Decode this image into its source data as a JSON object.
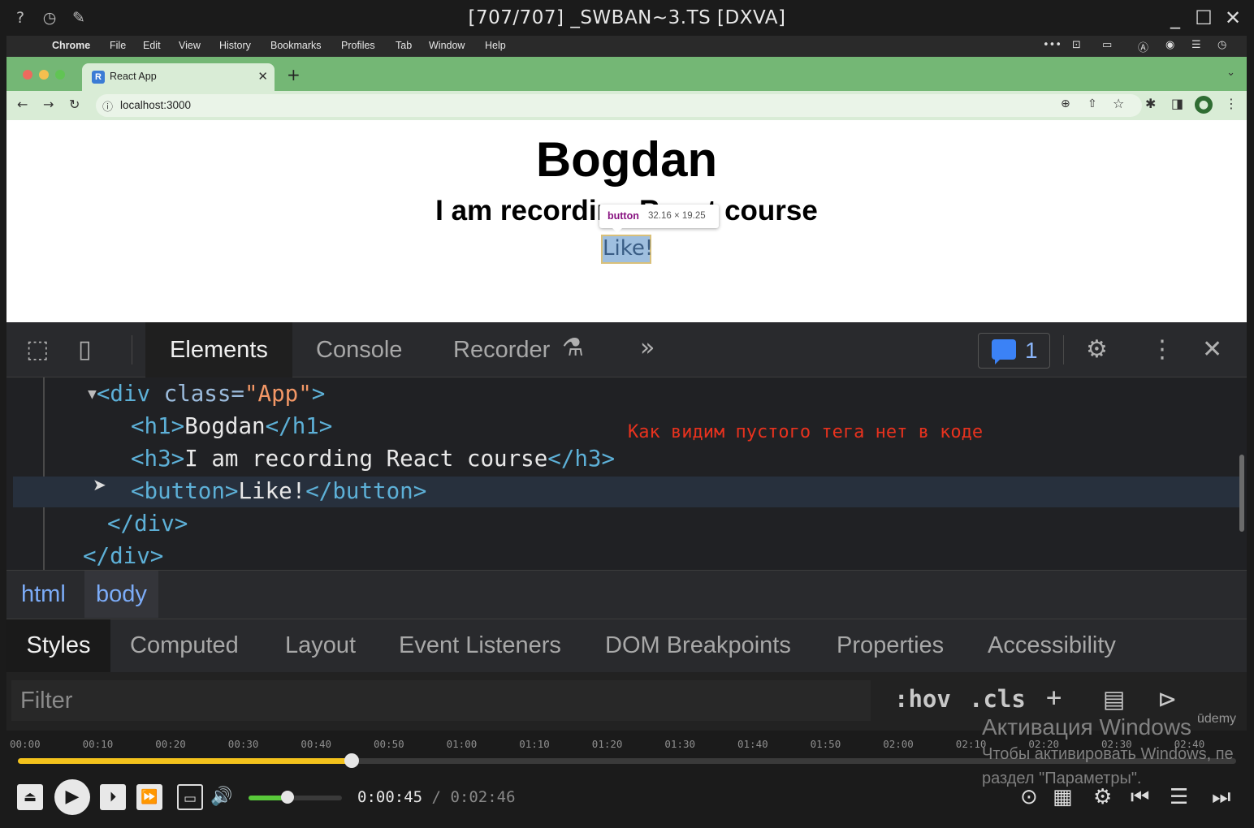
{
  "player": {
    "title": "[707/707] _SWBAN~3.TS [DXVA]",
    "left_icons": [
      "help-icon",
      "history-icon",
      "pin-icon"
    ],
    "window_controls": [
      "minimize-icon",
      "maximize-icon",
      "close-icon"
    ]
  },
  "mac_menu": {
    "items": [
      "Chrome",
      "File",
      "Edit",
      "View",
      "History",
      "Bookmarks",
      "Profiles",
      "Tab",
      "Window",
      "Help"
    ]
  },
  "browser": {
    "tab_title": "React App",
    "tab_favicon": "R",
    "address": "localhost:3000"
  },
  "page": {
    "h1": "Bogdan",
    "h3": "I am recording React course",
    "button": "Like!",
    "tooltip_tag": "button",
    "tooltip_size": "32.16 × 19.25"
  },
  "devtools": {
    "tabs": [
      "Elements",
      "Console",
      "Recorder"
    ],
    "active_tab": "Elements",
    "issues_count": "1",
    "dom": {
      "l1_tag_open": "<div",
      "l1_attr": " class=",
      "l1_val": "\"App\"",
      "l1_close": ">",
      "l2_open": "<h1>",
      "l2_text": "Bogdan",
      "l2_close": "</h1>",
      "l3_open": "<h3>",
      "l3_text": "I am recording React course",
      "l3_close": "</h3>",
      "l4_open": "<button>",
      "l4_text": "Like!",
      "l4_close": "</button>",
      "l5": "</div>",
      "l6": "</div>"
    },
    "annotation": "Как видим пустого тега нет в коде",
    "breadcrumbs": [
      "html",
      "body"
    ],
    "subtabs": [
      "Styles",
      "Computed",
      "Layout",
      "Event Listeners",
      "DOM Breakpoints",
      "Properties",
      "Accessibility"
    ],
    "active_subtab": "Styles",
    "filter_placeholder": "Filter",
    "hov": ":hov",
    "cls": ".cls"
  },
  "seekbar": {
    "ticks": [
      "00:00",
      "00:10",
      "00:20",
      "00:30",
      "00:40",
      "00:50",
      "01:00",
      "01:10",
      "01:20",
      "01:30",
      "01:40",
      "01:50",
      "02:00",
      "02:10",
      "02:20",
      "02:30",
      "02:40"
    ],
    "progress_fraction": 0.274,
    "volume_fraction": 0.42,
    "current_time": "0:00:45",
    "separator": "/",
    "total_time": "0:02:46"
  },
  "watermark": {
    "line1": "Активация Windows",
    "line2": "Чтобы активировать Windows, пе",
    "line3": "раздел \"Параметры\".",
    "udemy": "ūdemy"
  },
  "colors": {
    "tab_strip": "#74b775",
    "annotation": "#e8321e",
    "seek_fill": "#f3c21c",
    "volume_fill": "#59c93a"
  }
}
